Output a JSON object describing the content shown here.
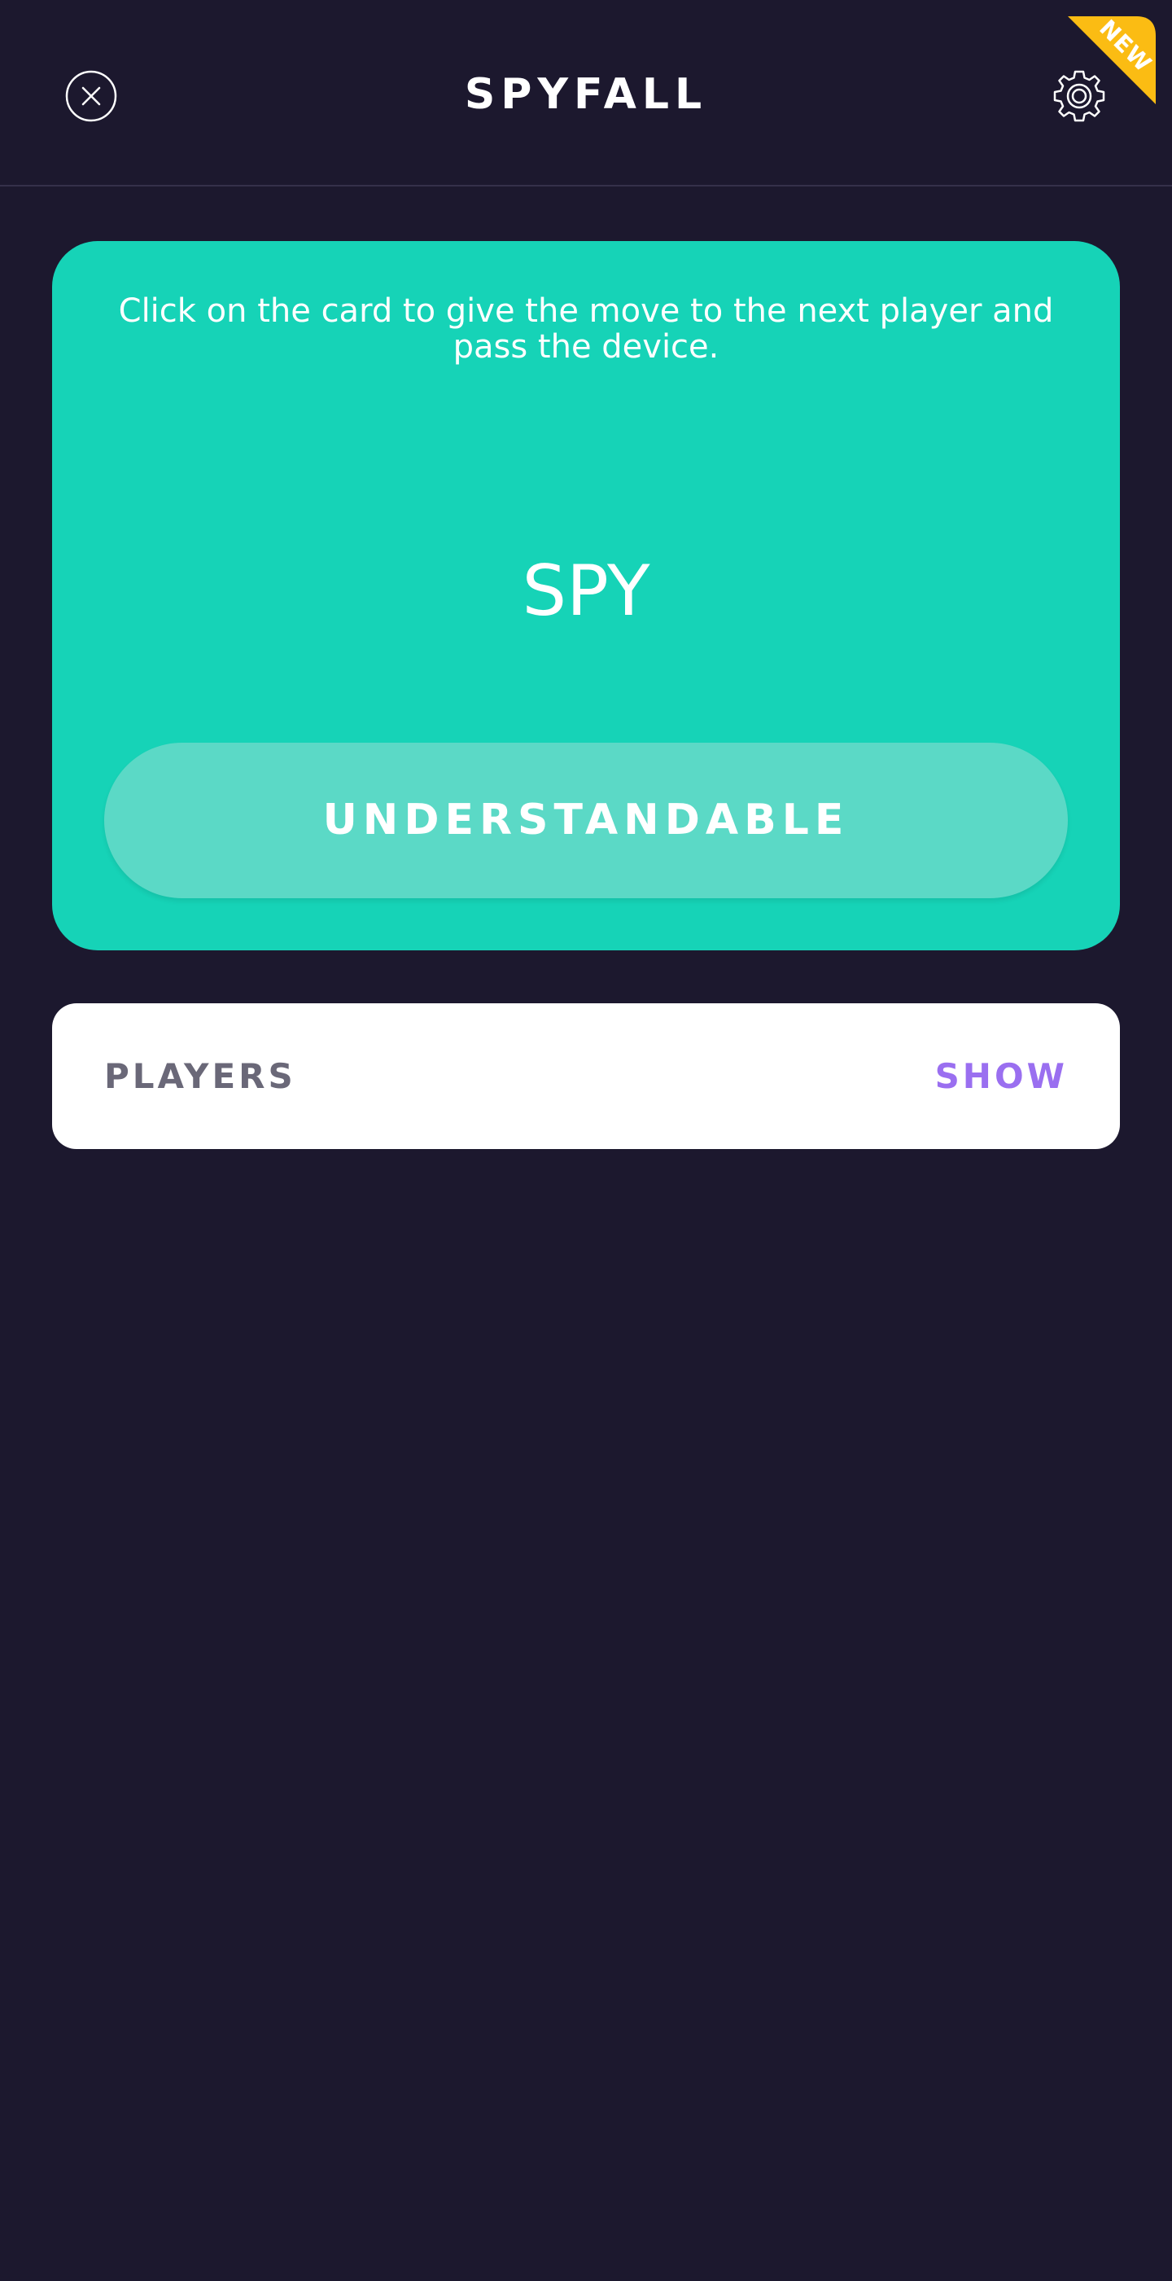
{
  "header": {
    "title": "SPYFALL",
    "close_icon": "close-circle-icon",
    "settings_icon": "gear-icon",
    "badge": "NEW"
  },
  "card": {
    "instruction": "Click on the card to give the move to the next player and pass the device.",
    "role": "SPY",
    "confirm_label": "UNDERSTANDABLE"
  },
  "players": {
    "label": "PLAYERS",
    "show_label": "SHOW"
  },
  "colors": {
    "background": "#1c182e",
    "card": "#16d3b7",
    "button": "#5bd9c6",
    "badge": "#fbbc13",
    "link": "#9a6ff0"
  }
}
